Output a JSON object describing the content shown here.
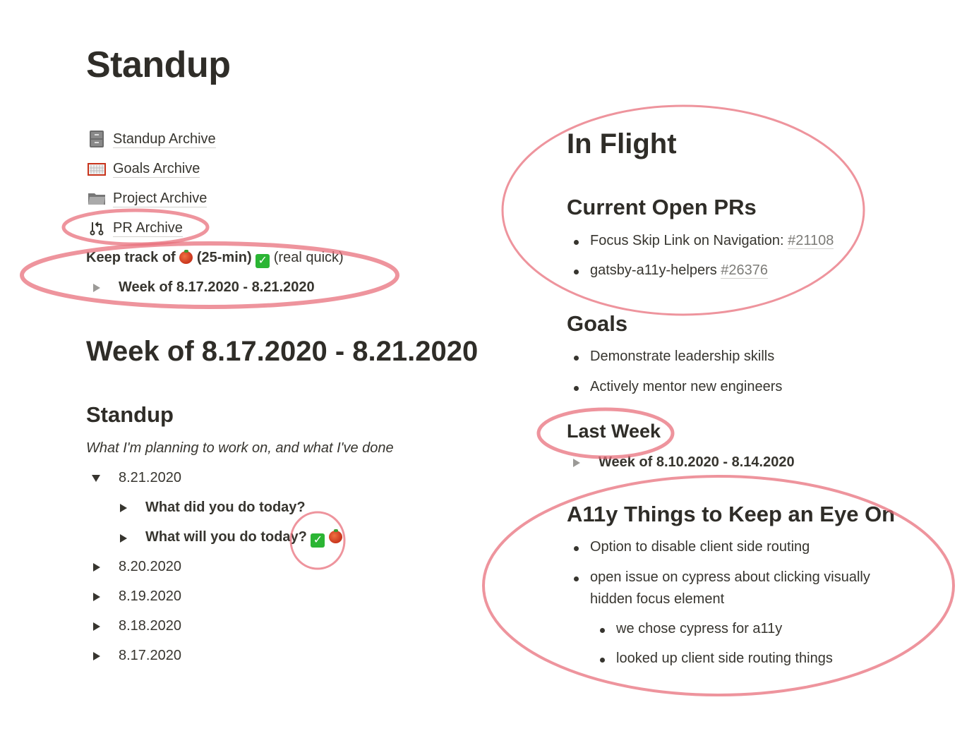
{
  "page": {
    "title": "Standup",
    "links": [
      {
        "icon": "file-cabinet-icon",
        "label": "Standup Archive"
      },
      {
        "icon": "goal-net-icon",
        "label": "Goals Archive"
      },
      {
        "icon": "folder-icon",
        "label": "Project Archive"
      },
      {
        "icon": "pull-request-icon",
        "label": "PR Archive"
      }
    ],
    "keep_track": {
      "prefix": "Keep track of",
      "tomato_note": "(25-min)",
      "check_note": "(real quick)"
    },
    "week_toggle": "Week of 8.17.2020 - 8.21.2020"
  },
  "week": {
    "heading": "Week of 8.17.2020 - 8.21.2020",
    "standup": {
      "heading": "Standup",
      "subtitle": "What I'm planning to work on, and what I've done",
      "days": [
        {
          "label": "8.21.2020",
          "expanded": true,
          "children": [
            {
              "label": "What did you do today?"
            },
            {
              "label": "What will you do today?"
            }
          ]
        },
        {
          "label": "8.20.2020",
          "expanded": false
        },
        {
          "label": "8.19.2020",
          "expanded": false
        },
        {
          "label": "8.18.2020",
          "expanded": false
        },
        {
          "label": "8.17.2020",
          "expanded": false
        }
      ]
    }
  },
  "right": {
    "in_flight": "In Flight",
    "open_prs": {
      "heading": "Current Open PRs",
      "items": [
        {
          "text": "Focus Skip Link on Navigation:",
          "link": "#21108"
        },
        {
          "text": "gatsby-a11y-helpers",
          "link": "#26376"
        }
      ]
    },
    "goals": {
      "heading": "Goals",
      "items": [
        "Demonstrate leadership skills",
        "Actively mentor new engineers"
      ]
    },
    "last_week": {
      "heading": "Last Week",
      "toggle": "Week of 8.10.2020 - 8.14.2020"
    },
    "a11y": {
      "heading": "A11y Things to Keep an Eye On",
      "items": [
        {
          "text": "Option to disable client side routing"
        },
        {
          "text": "open issue on cypress about clicking visually",
          "text2": "hidden focus element",
          "children": [
            "we chose cypress for a11y",
            "looked up client side routing things"
          ]
        }
      ]
    }
  },
  "colors": {
    "annotation": "#e8707c",
    "text": "#37352f",
    "link": "#7d7c78"
  }
}
